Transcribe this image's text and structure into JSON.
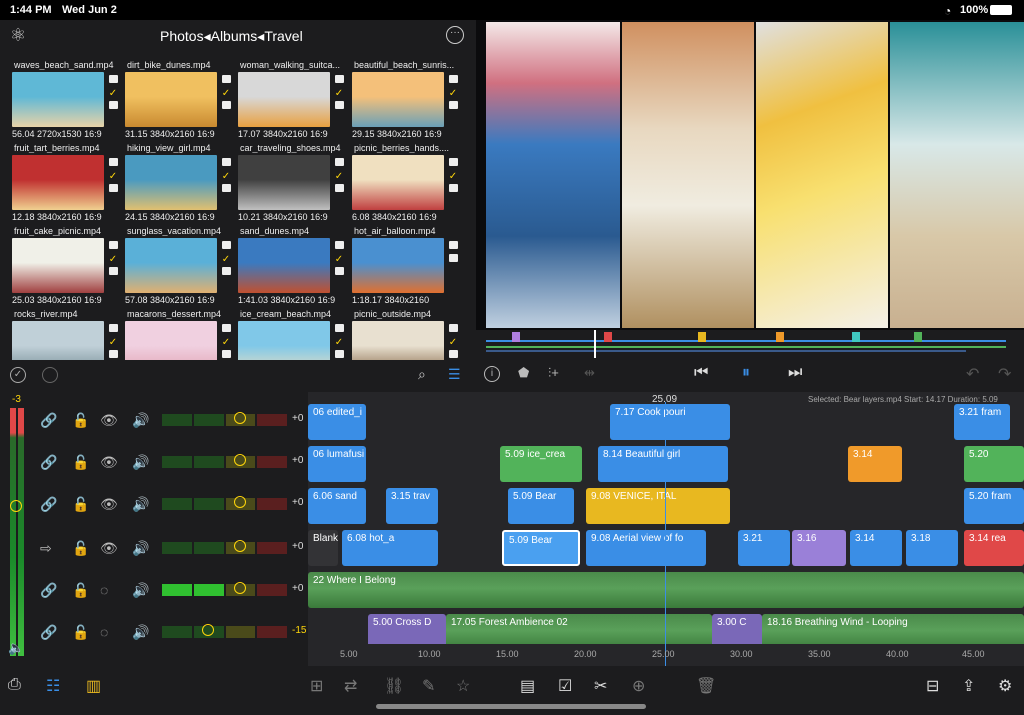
{
  "status": {
    "time": "1:44 PM",
    "date": "Wed Jun 2",
    "battery": "100%"
  },
  "browser": {
    "breadcrumb": "Photos◂Albums◂Travel",
    "items": [
      {
        "name": "waves_beach_sand.mp4",
        "meta": "56.04  2720x1530  16:9",
        "checked": true,
        "c1": "#5fb8d6",
        "c2": "#e8d3a8"
      },
      {
        "name": "dirt_bike_dunes.mp4",
        "meta": "31.15  3840x2160  16:9",
        "checked": true,
        "c1": "#f0c060",
        "c2": "#c98a30"
      },
      {
        "name": "woman_walking_suitca...",
        "meta": "17.07  3840x2160  16:9",
        "checked": true,
        "c1": "#d8d8d8",
        "c2": "#e8a040"
      },
      {
        "name": "beautiful_beach_sunris...",
        "meta": "29.15  3840x2160  16:9",
        "checked": true,
        "c1": "#f4c07a",
        "c2": "#6aa0b8"
      },
      {
        "name": "fruit_tart_berries.mp4",
        "meta": "12.18  3840x2160  16:9",
        "checked": true,
        "c1": "#c03030",
        "c2": "#f0d090"
      },
      {
        "name": "hiking_view_girl.mp4",
        "meta": "24.15  3840x2160  16:9",
        "checked": true,
        "c1": "#4a9ac0",
        "c2": "#e0c070"
      },
      {
        "name": "car_traveling_shoes.mp4",
        "meta": "10.21  3840x2160  16:9",
        "checked": true,
        "c1": "#404040",
        "c2": "#c0c0c0"
      },
      {
        "name": "picnic_berries_hands....",
        "meta": "6.08  3840x2160  16:9",
        "checked": true,
        "c1": "#f0e0c0",
        "c2": "#c04040"
      },
      {
        "name": "fruit_cake_picnic.mp4",
        "meta": "25.03  3840x2160  16:9",
        "checked": true,
        "c1": "#f0f0e8",
        "c2": "#a04040"
      },
      {
        "name": "sunglass_vacation.mp4",
        "meta": "57.08  3840x2160  16:9",
        "checked": true,
        "c1": "#5ab0d8",
        "c2": "#e0b070"
      },
      {
        "name": "sand_dunes.mp4",
        "meta": "1:41.03  3840x2160  16:9",
        "checked": true,
        "c1": "#3a7ac0",
        "c2": "#c05030"
      },
      {
        "name": "hot_air_balloon.mp4",
        "meta": "1:18.17  3840x2160",
        "checked": false,
        "c1": "#4a90d0",
        "c2": "#e07030"
      },
      {
        "name": "rocks_river.mp4",
        "meta": "",
        "checked": true,
        "c1": "#c0d0d8",
        "c2": "#708890"
      },
      {
        "name": "macarons_dessert.mp4",
        "meta": "",
        "checked": true,
        "c1": "#f0d0e0",
        "c2": "#e0a0b0"
      },
      {
        "name": "ice_cream_beach.mp4",
        "meta": "",
        "checked": true,
        "c1": "#80c8e8",
        "c2": "#f0e0c0"
      },
      {
        "name": "picnic_outside.mp4",
        "meta": "",
        "checked": true,
        "c1": "#e8e0d0",
        "c2": "#806040"
      }
    ]
  },
  "timeline": {
    "playhead": "25.09",
    "selected_info": "Selected: Bear layers.mp4 Start: 14.17 Duration: 5.09",
    "ruler": [
      "5.00",
      "10.00",
      "15.00",
      "20.00",
      "25.00",
      "30.00",
      "35.00",
      "40.00",
      "45.00"
    ],
    "level_top": "-3",
    "tracks": [
      {
        "gain": "+0",
        "clips": [
          {
            "label": "06  edited_i",
            "color": "blue"
          },
          {
            "label": "7.17  Cook pouri",
            "color": "blue"
          },
          {
            "label": "3.21  fram",
            "color": "blue"
          }
        ]
      },
      {
        "gain": "+0",
        "clips": [
          {
            "label": "06  lumafusi",
            "color": "blue"
          },
          {
            "label": "5.09  ice_crea",
            "color": "green"
          },
          {
            "label": "8.14  Beautiful girl",
            "color": "blue"
          },
          {
            "label": "3.14",
            "color": "orange"
          },
          {
            "label": "5.20",
            "color": "green"
          }
        ]
      },
      {
        "gain": "+0",
        "clips": [
          {
            "label": "6.06  sand",
            "color": "blue"
          },
          {
            "label": "3.15  trav",
            "color": "blue"
          },
          {
            "label": "5.09  Bear",
            "color": "blue"
          },
          {
            "label": "9.08  VENICE, ITAL",
            "color": "yellow"
          },
          {
            "label": "5.20  fram",
            "color": "blue"
          }
        ]
      },
      {
        "gain": "+0",
        "clips": [
          {
            "label": "Blank",
            "color": "dark"
          },
          {
            "label": "6.08  hot_a",
            "color": "blue"
          },
          {
            "label": "5.09  Bear",
            "color": "selected"
          },
          {
            "label": "9.08  Aerial view of fo",
            "color": "blue"
          },
          {
            "label": "3.21",
            "color": "blue"
          },
          {
            "label": "3.16",
            "color": "purple"
          },
          {
            "label": "3.14",
            "color": "blue"
          },
          {
            "label": "3.18",
            "color": "blue"
          },
          {
            "label": "3.14  rea",
            "color": "red"
          }
        ]
      },
      {
        "gain": "+0",
        "clips": [
          {
            "label": "22  Where I Belong",
            "color": "green"
          }
        ]
      },
      {
        "gain": "-15",
        "clips": [
          {
            "label": "5.00  Cross D",
            "color": "purple"
          },
          {
            "label": "17.05  Forest Ambience 02",
            "color": "green"
          },
          {
            "label": "3.00  C",
            "color": "purple"
          },
          {
            "label": "18.16  Breathing Wind - Looping",
            "color": "green"
          }
        ]
      }
    ]
  }
}
